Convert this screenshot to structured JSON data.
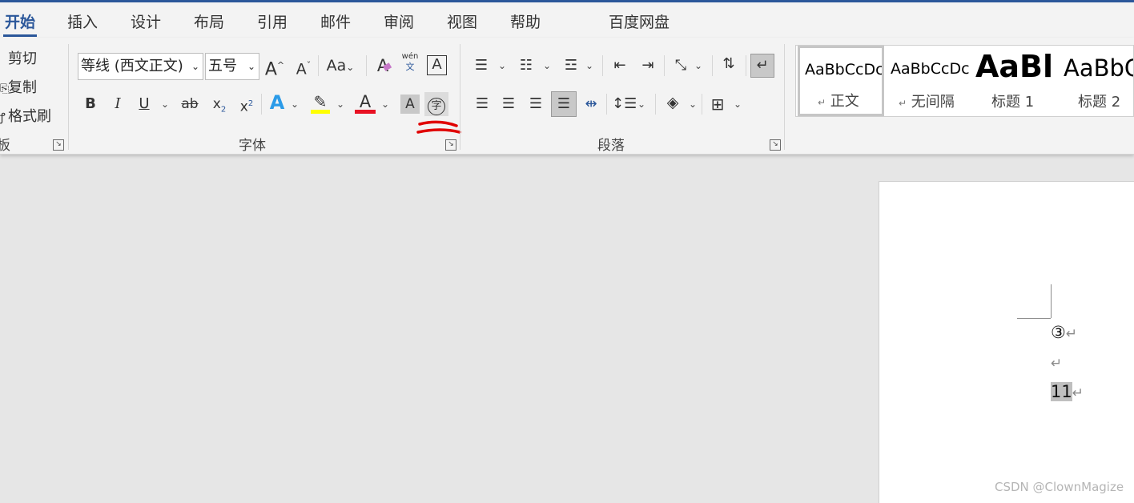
{
  "tabs": [
    "开始",
    "插入",
    "设计",
    "布局",
    "引用",
    "邮件",
    "审阅",
    "视图",
    "帮助",
    "百度网盘"
  ],
  "clipboard": {
    "cut": "剪切",
    "copy": "复制",
    "format_painter": "格式刷",
    "group_label": "板"
  },
  "font": {
    "name": "等线 (西文正文)",
    "size": "五号",
    "grow": "A",
    "shrink": "A",
    "change_case": "Aa",
    "phonetic_top": "wén",
    "phonetic_bottom": "文",
    "char_border": "A",
    "bold": "B",
    "italic": "I",
    "underline": "U",
    "strike": "ab",
    "subscript": "x",
    "sub_mark": "2",
    "superscript": "x",
    "sup_mark": "2",
    "text_effect": "A",
    "highlight_color": "#ffff00",
    "font_color_letter": "A",
    "font_color": "#e81123",
    "char_shading": "A",
    "enclose_char": "字",
    "group_label": "字体"
  },
  "paragraph": {
    "group_label": "段落"
  },
  "styles": [
    {
      "preview": "AaBbCcDc",
      "name": "正文",
      "mark": "↵"
    },
    {
      "preview": "AaBbCcDc",
      "name": "无间隔",
      "mark": "↵"
    },
    {
      "preview": "AaBl",
      "name": "标题 1",
      "mark": ""
    },
    {
      "preview": "AaBbC",
      "name": "标题 2",
      "mark": ""
    }
  ],
  "document": {
    "line1": "③",
    "line1_mark": "↵",
    "line2_mark": "↵",
    "line3": "11",
    "line3_mark": "↵"
  },
  "watermark": "CSDN @ClownMagize",
  "annotation_color": "#e00000"
}
